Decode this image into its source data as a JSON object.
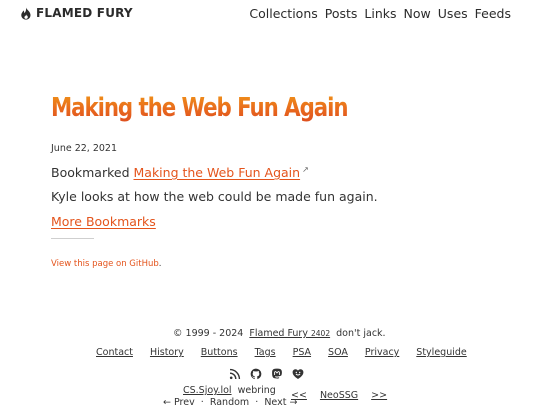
{
  "header": {
    "brand": "FLAMED FURY",
    "brand_icon": "flame-icon",
    "nav": [
      "Collections",
      "Posts",
      "Links",
      "Now",
      "Uses",
      "Feeds"
    ]
  },
  "post": {
    "title": "Making the Web Fun Again",
    "date": "June 22, 2021",
    "bookmarked_prefix": "Bookmarked",
    "bookmark_link": "Making the Web Fun Again",
    "summary": "Kyle looks at how the web could be made fun again.",
    "more_link": "More Bookmarks",
    "github_link": "View this page on GitHub",
    "github_suffix": "."
  },
  "footer": {
    "copyright_prefix": "© 1999 - 2024",
    "site_name": "Flamed Fury",
    "site_year": "2402",
    "tagline": "don't jack.",
    "links": [
      "Contact",
      "History",
      "Buttons",
      "Tags",
      "PSA",
      "SOA",
      "Privacy",
      "Styleguide"
    ],
    "icons": [
      "rss-icon",
      "github-icon",
      "mastodon-icon",
      "heart-smile-icon"
    ],
    "webring_link": "CS.Sjoy.lol",
    "webring_label": "webring",
    "ring_prev": "← Prev",
    "ring_random": "Random",
    "ring_next": "Next →",
    "ring_sep": "·",
    "neossg_prev": "<<",
    "neossg_label": "NeoSSG",
    "neossg_next": ">>"
  },
  "colors": {
    "accent": "#e4541c",
    "title_gradient_top": "#f2a016",
    "title_gradient_bottom": "#d9421f"
  }
}
